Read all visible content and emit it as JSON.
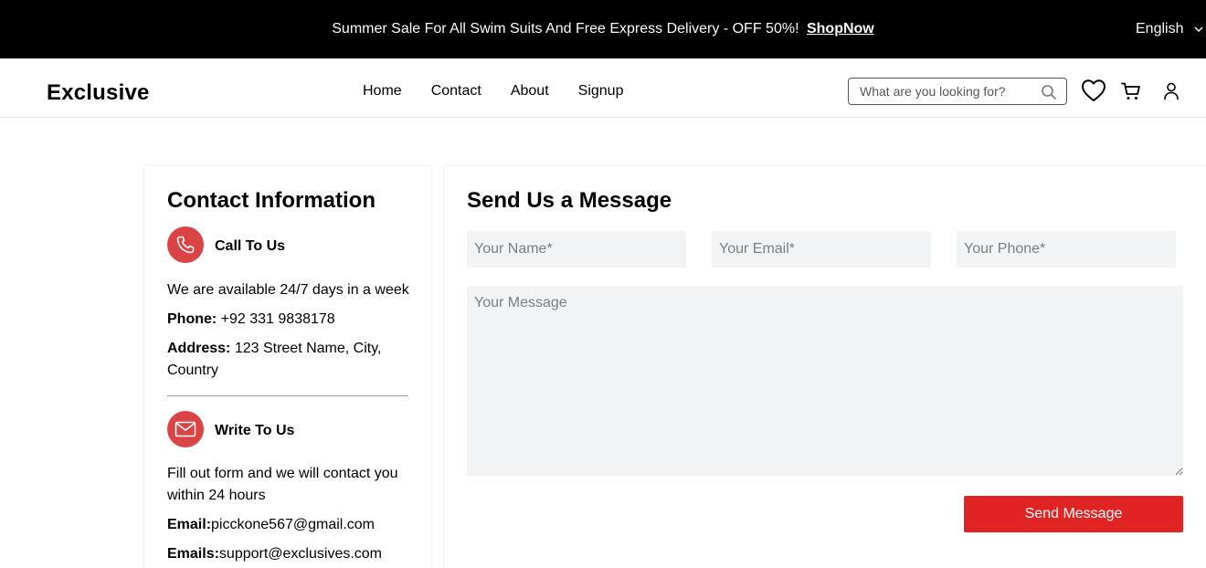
{
  "banner": {
    "promo_text": "Summer Sale For All Swim Suits And Free Express Delivery - OFF 50%!",
    "shop_link": "ShopNow",
    "language": "English"
  },
  "header": {
    "logo": "Exclusive",
    "nav": [
      "Home",
      "Contact",
      "About",
      "Signup"
    ],
    "search_placeholder": "What are you looking for?",
    "icons": [
      "heart-icon",
      "cart-icon",
      "user-icon",
      "search-icon"
    ]
  },
  "contact_info": {
    "title": "Contact Information",
    "call": {
      "heading": "Call To Us",
      "availability": "We are available 24/7 days in a week",
      "phone_label": "Phone:",
      "phone_value": "+92 331 9838178",
      "address_label": "Address:",
      "address_value": "123 Street Name, City, Country"
    },
    "write": {
      "heading": "Write To Us",
      "description": "Fill out form and we will contact you within 24 hours",
      "email_label": "Email:",
      "email_value": "picckone567@gmail.com",
      "emails_label": "Emails:",
      "emails_value": "support@exclusives.com"
    }
  },
  "message_form": {
    "title": "Send Us a Message",
    "name_placeholder": "Your Name*",
    "email_placeholder": "Your Email*",
    "phone_placeholder": "Your Phone*",
    "message_placeholder": "Your Message",
    "submit_label": "Send Message"
  },
  "colors": {
    "accent": "#db4444",
    "button": "#e02424",
    "input_bg": "#f2f3f5",
    "banner_bg": "#000000"
  }
}
